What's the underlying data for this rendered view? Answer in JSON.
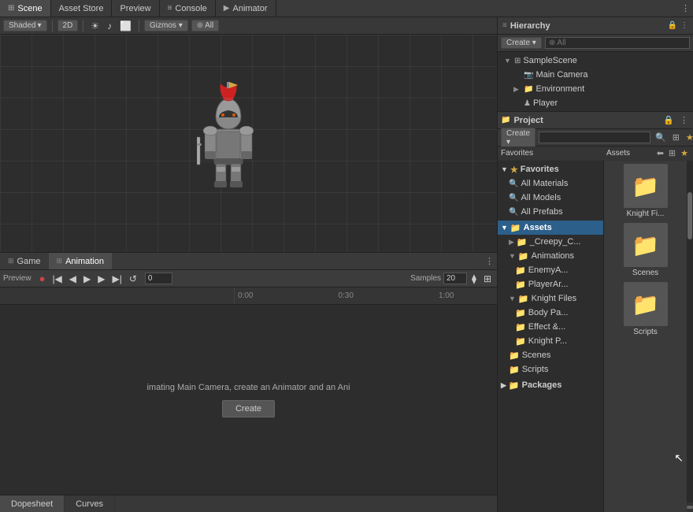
{
  "tabs": {
    "scene": {
      "label": "Scene",
      "icon": "⊞",
      "active": true
    },
    "asset_store": {
      "label": "Asset Store",
      "icon": "🏪",
      "active": false
    },
    "preview": {
      "label": "Preview",
      "icon": "",
      "active": false
    },
    "console": {
      "label": "Console",
      "icon": "≡",
      "active": false
    },
    "animator": {
      "label": "Animator",
      "icon": "▶",
      "active": false
    }
  },
  "scene_toolbar": {
    "shaded": "Shaded",
    "mode_2d": "2D",
    "gizmos": "Gizmos ▾",
    "all_tag": "All"
  },
  "hierarchy": {
    "title": "Hierarchy",
    "create_label": "Create ▾",
    "search_placeholder": "⊕ All",
    "sample_scene": "SampleScene",
    "items": [
      {
        "label": "Main Camera",
        "icon": "📷",
        "level": 1
      },
      {
        "label": "Environment",
        "icon": "📁",
        "level": 1,
        "has_arrow": true
      },
      {
        "label": "Player",
        "icon": "♟",
        "level": 1
      }
    ]
  },
  "project": {
    "title": "Project",
    "create_label": "Create ▾",
    "search_placeholder": "",
    "favorites_label": "Favorites",
    "assets_label": "Assets",
    "favorites": [
      {
        "label": "All Materials",
        "icon": "🔍"
      },
      {
        "label": "All Models",
        "icon": "🔍"
      },
      {
        "label": "All Prefabs",
        "icon": "🔍"
      }
    ],
    "assets_tree": [
      {
        "label": "Assets",
        "level": 0,
        "expanded": true,
        "selected": true
      },
      {
        "label": "_Creepy_C...",
        "level": 1,
        "expanded": false
      },
      {
        "label": "Animations",
        "level": 1,
        "expanded": true
      },
      {
        "label": "EnemyA...",
        "level": 2
      },
      {
        "label": "PlayerAr...",
        "level": 2
      },
      {
        "label": "Knight Files",
        "level": 1,
        "expanded": true
      },
      {
        "label": "Body Pa...",
        "level": 2
      },
      {
        "label": "Effect &...",
        "level": 2
      },
      {
        "label": "Knight P...",
        "level": 2
      },
      {
        "label": "Scenes",
        "level": 1
      },
      {
        "label": "Scripts",
        "level": 1
      }
    ],
    "packages_label": "Packages",
    "asset_thumbnails": [
      {
        "label": "Knight Fi...",
        "icon": "📁"
      },
      {
        "label": "Scenes",
        "icon": "📁"
      },
      {
        "label": "Scripts",
        "icon": "📁"
      }
    ]
  },
  "animation": {
    "game_tab": "Game",
    "anim_tab": "Animation",
    "anim_tab_icon": "⊞",
    "samples_label": "Samples",
    "samples_value": "20",
    "timeline_labels": [
      "0",
      "0:00",
      "0:30",
      "1:00"
    ],
    "message": "imating Main Camera, create an Animator and an Ani",
    "create_btn": "Create",
    "dopesheet_tab": "Dopesheet",
    "curves_tab": "Curves"
  }
}
